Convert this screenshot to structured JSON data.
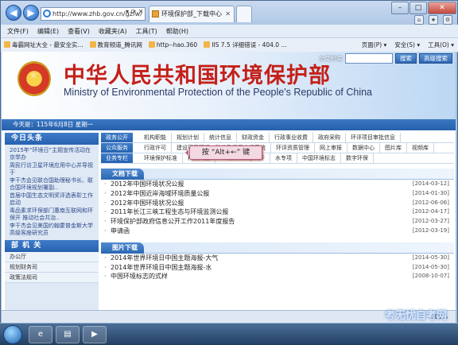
{
  "browser": {
    "address": "http://www.zhb.gov.cn/gzfw/",
    "tab_title": "环境保护部_下载中心",
    "menu": [
      "文件(F)",
      "编辑(E)",
      "查看(V)",
      "收藏夹(A)",
      "工具(T)",
      "帮助(H)"
    ],
    "favorites": [
      "毒霸网址大全 - 最安全实...",
      "教育频道_腾讯网",
      "http--hao.360",
      "IIS 7.5 详细错误 - 404.0 ..."
    ],
    "fav_right": [
      "页面(P) ▾",
      "安全(S) ▾",
      "工具(O) ▾"
    ],
    "zoom": "100%"
  },
  "site": {
    "title_cn": "中华人民共和国环境保护部",
    "title_en": "Ministry of Environmental Protection of the People's Republic of China",
    "search_label": "全文检索",
    "search_button": "高级搜索",
    "date": "今天是：115年6月8日  星期一"
  },
  "left": {
    "news_title": "今日头条",
    "news": [
      "2015年“环境日”主题宣传活动在京举办",
      "周民行访卫星环境应用中心并导视于",
      "李干杰会见联合国助理秘书长、联合国环境规划署副..",
      "首届中国生态文明奖评选表彰工作启动",
      "毒品素求环保部门惠南互联网和环保开 推动社会共治..",
      "李干杰会见美国约翰霍普金斯大学高级客座研究员"
    ],
    "dept_title": "部 机 关",
    "dept": [
      "办公厅",
      "规划财务司",
      "政策法规司"
    ]
  },
  "nav": [
    {
      "cat": "政务公开",
      "links": [
        "机构职能",
        "规划计划",
        "统计信息",
        "财政资金",
        "行政事业收费",
        "政府采购",
        "环评项目审批信息"
      ]
    },
    {
      "cat": "公众服务",
      "links": [
        "行政许可",
        "建设项目环评、验收及资质申报系统",
        "环评资质管理",
        "网上审报",
        "数据中心",
        "图片库",
        "视频库"
      ]
    },
    {
      "cat": "业务专栏",
      "links": [
        "环境保护标准",
        "科技奖励",
        "环境执法信息公开",
        "水专项",
        "中国环境标志",
        "数字环保"
      ]
    }
  ],
  "docs": {
    "title": "文档下载",
    "items": [
      {
        "t": "2012年中国环境状况公报",
        "d": "[2014-03-12]"
      },
      {
        "t": "2012年中国近岸海域环境质量公报",
        "d": "[2014-01-30]"
      },
      {
        "t": "2012年中国环境状况公报",
        "d": "[2012-06-06]"
      },
      {
        "t": "2011年长江三峡工程生态与环境监测公报",
        "d": "[2012-04-17]"
      },
      {
        "t": "环境保护部政府信息公开工作2011年度报告",
        "d": "[2012-03-27]"
      },
      {
        "t": "申请函",
        "d": "[2012-03-19]"
      }
    ]
  },
  "pics": {
    "title": "图片下载",
    "items": [
      {
        "t": "2014年世界环境日中国主题海报-大气",
        "d": "[2014-05-30]"
      },
      {
        "t": "2014年世界环境日中国主题海报-水",
        "d": "[2014-05-30]"
      },
      {
        "t": "中国环境标志的式样",
        "d": "[2008-10-07]"
      }
    ]
  },
  "overlay": "按 “Alt+←” 键",
  "watermark": "考无忧自考网"
}
